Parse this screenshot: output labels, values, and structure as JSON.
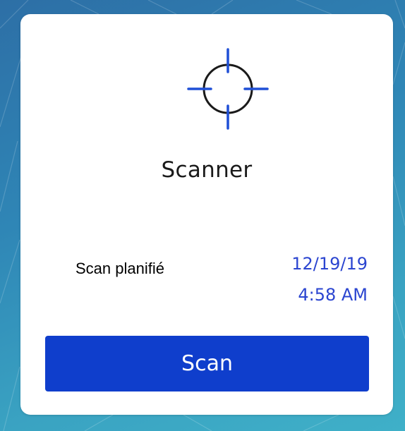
{
  "colors": {
    "accent": "#0f3ecc",
    "schedule_text": "#2b45d0",
    "card_background": "#ffffff"
  },
  "widget": {
    "icon": "crosshair-icon",
    "title": "Scanner",
    "schedule_label": "Scan planifié",
    "schedule_date": "12/19/19",
    "schedule_time": "4:58 AM",
    "button_label": "Scan"
  }
}
